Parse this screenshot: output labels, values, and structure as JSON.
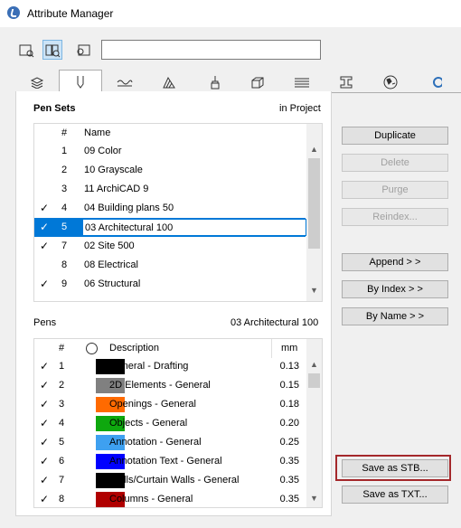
{
  "window": {
    "title": "Attribute Manager"
  },
  "search": {
    "value": ""
  },
  "pen_sets": {
    "label": "Pen Sets",
    "location": "in Project",
    "col_num": "#",
    "col_name": "Name",
    "rows": [
      {
        "check": "",
        "num": "1",
        "name": "09 Color"
      },
      {
        "check": "",
        "num": "2",
        "name": "10 Grayscale"
      },
      {
        "check": "",
        "num": "3",
        "name": "11 ArchiCAD 9"
      },
      {
        "check": "✓",
        "num": "4",
        "name": "04 Building plans 50"
      },
      {
        "check": "✓",
        "num": "5",
        "name": "03 Architectural 100"
      },
      {
        "check": "✓",
        "num": "7",
        "name": "02 Site 500"
      },
      {
        "check": "",
        "num": "8",
        "name": "08 Electrical"
      },
      {
        "check": "✓",
        "num": "9",
        "name": "06 Structural"
      }
    ]
  },
  "pens": {
    "label": "Pens",
    "current_set": "03 Architectural 100",
    "col_num": "#",
    "col_desc": "Description",
    "col_mm": "mm",
    "rows": [
      {
        "check": "✓",
        "num": "1",
        "color": "#000000",
        "desc": "General - Drafting",
        "mm": "0.13"
      },
      {
        "check": "✓",
        "num": "2",
        "color": "#808080",
        "desc": "2D Elements - General",
        "mm": "0.15"
      },
      {
        "check": "✓",
        "num": "3",
        "color": "#ff6a00",
        "desc": "Openings - General",
        "mm": "0.18"
      },
      {
        "check": "✓",
        "num": "4",
        "color": "#0ea80e",
        "desc": "Objects - General",
        "mm": "0.20"
      },
      {
        "check": "✓",
        "num": "5",
        "color": "#3ea0f0",
        "desc": "Annotation - General",
        "mm": "0.25"
      },
      {
        "check": "✓",
        "num": "6",
        "color": "#0000ff",
        "desc": "Annotation Text  - General",
        "mm": "0.35"
      },
      {
        "check": "✓",
        "num": "7",
        "color": "#000000",
        "desc": "Walls/Curtain Walls - General",
        "mm": "0.35"
      },
      {
        "check": "✓",
        "num": "8",
        "color": "#b00000",
        "desc": "Columns - General",
        "mm": "0.35"
      }
    ]
  },
  "buttons": {
    "duplicate": "Duplicate",
    "delete": "Delete",
    "purge": "Purge",
    "reindex": "Reindex...",
    "append": "Append > >",
    "by_index": "By Index > >",
    "by_name": "By Name > >",
    "save_stb": "Save as STB...",
    "save_txt": "Save as TXT..."
  },
  "colors": {
    "selection": "#0078d7",
    "highlight_frame": "#a4282b"
  }
}
